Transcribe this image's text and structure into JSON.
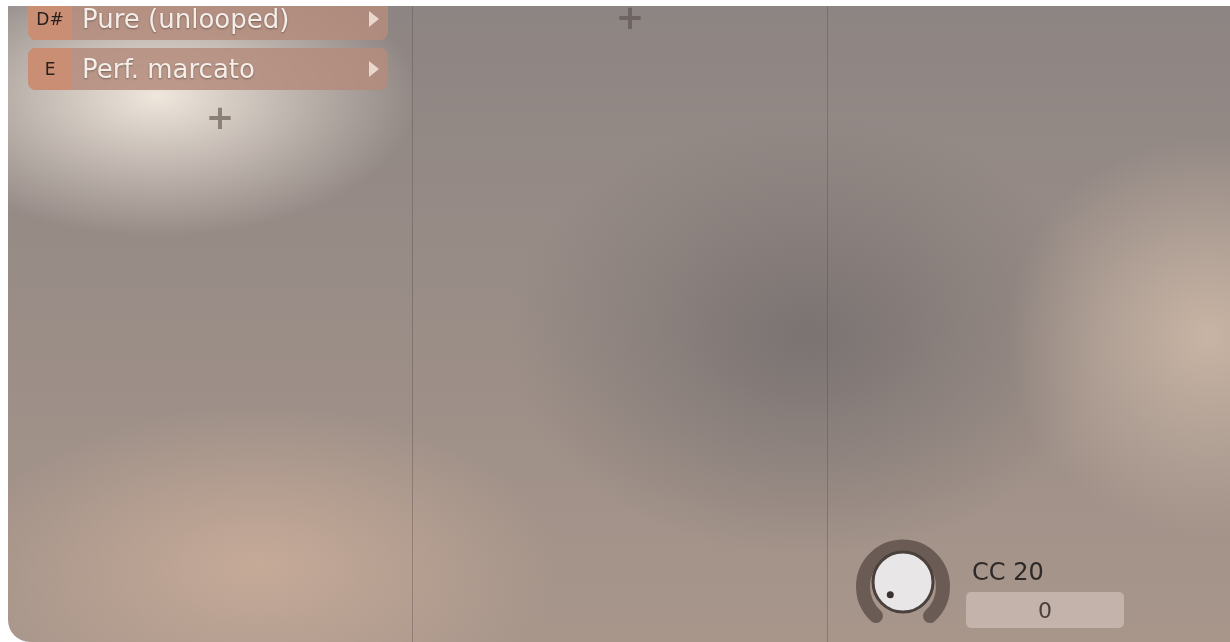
{
  "columns": [
    {
      "articulations": [
        {
          "key": "D#",
          "name": "Pure (unlooped)"
        },
        {
          "key": "E",
          "name": "Perf. marcato"
        }
      ],
      "add_label": "+"
    },
    {
      "add_label": "+"
    }
  ],
  "knob": {
    "label": "CC 20",
    "value": "0"
  }
}
